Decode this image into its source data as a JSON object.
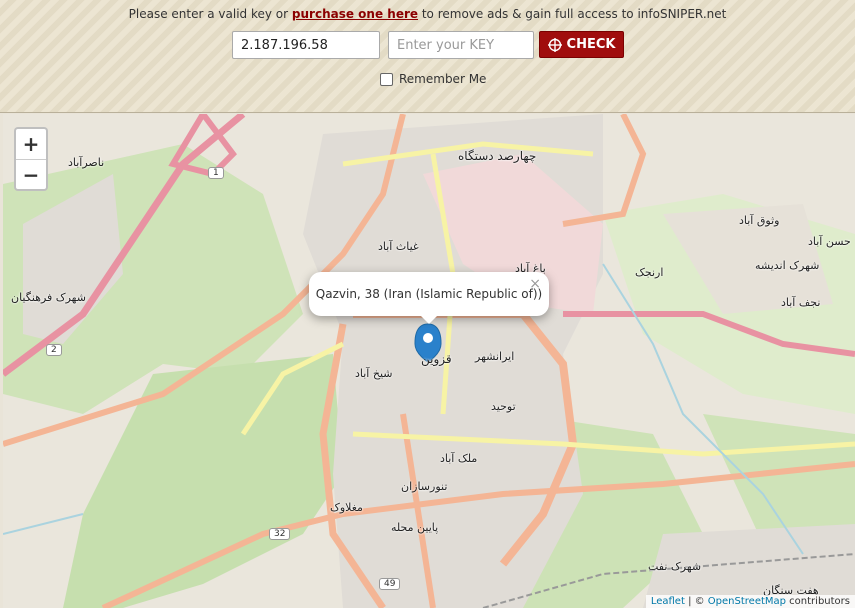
{
  "header": {
    "notice_before": "Please enter a valid key or",
    "notice_link": "purchase one here",
    "notice_after": "to remove ads & gain full access to infoSNIPER.net",
    "ip_value": "2.187.196.58",
    "key_placeholder": "Enter your KEY",
    "check_label": "CHECK",
    "remember_label": "Remember Me"
  },
  "map": {
    "zoom_in": "+",
    "zoom_out": "−",
    "popup_text": "Qazvin, 38 (Iran (Islamic Republic of))",
    "popup_close": "×",
    "attribution_leaflet": "Leaflet",
    "attribution_sep": " | © ",
    "attribution_osm": "OpenStreetMap",
    "attribution_tail": " contributors",
    "labels": [
      {
        "text": "قزوین",
        "big": true
      },
      {
        "text": "چهارصد دستگاه",
        "big": true
      },
      {
        "text": "ناصرآباد"
      },
      {
        "text": "شهرک فرهنگیان"
      },
      {
        "text": "غیاث آباد"
      },
      {
        "text": "باغ آباد"
      },
      {
        "text": "ارنجک"
      },
      {
        "text": "وثوق آباد"
      },
      {
        "text": "حسن آباد"
      },
      {
        "text": "شهرک اندیشه"
      },
      {
        "text": "نجف آباد"
      },
      {
        "text": "ایرانشهر"
      },
      {
        "text": "شیخ آباد"
      },
      {
        "text": "توحید"
      },
      {
        "text": "ملک آباد"
      },
      {
        "text": "تنورسازان"
      },
      {
        "text": "مغلاوک"
      },
      {
        "text": "پایین محله"
      },
      {
        "text": "شهرک نفت"
      },
      {
        "text": "هفت سنگان"
      }
    ],
    "shields": [
      "1",
      "2",
      "32",
      "49"
    ]
  }
}
